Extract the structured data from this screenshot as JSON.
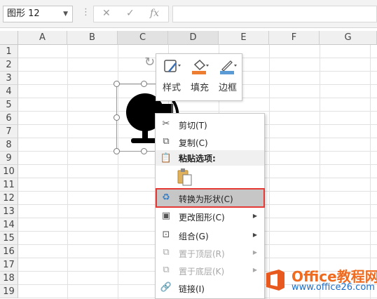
{
  "formula_bar": {
    "name_box": "图形 12",
    "more_icon": "more-vertical-icon",
    "cancel_icon": "close-icon",
    "enter_icon": "check-icon",
    "function_icon": "fx",
    "formula_value": ""
  },
  "columns": [
    "A",
    "B",
    "C",
    "D",
    "E",
    "F",
    "G"
  ],
  "rows": [
    "1",
    "2",
    "3",
    "4",
    "5",
    "6",
    "7",
    "8",
    "9",
    "10",
    "11",
    "12",
    "13",
    "14",
    "15",
    "16",
    "17",
    "18",
    "19"
  ],
  "selected_columns": [
    "C",
    "D"
  ],
  "mini_toolbar": [
    {
      "label": "样式",
      "icon": "style-icon"
    },
    {
      "label": "填充",
      "icon": "fill-bucket-icon"
    },
    {
      "label": "边框",
      "icon": "border-pen-icon"
    }
  ],
  "colors": {
    "fill_accent": "#ed7d31",
    "border_accent": "#5b9bd5",
    "highlight_border": "#e53935"
  },
  "context_menu": {
    "cut": "剪切(T)",
    "copy": "复制(C)",
    "paste_options": "粘贴选项:",
    "convert_to_shape": "转换为形状(C)",
    "change_graphic": "更改图形(C)",
    "group": "组合(G)",
    "bring_to_front": "置于顶层(R)",
    "send_to_back": "置于底层(K)",
    "link": "链接(I)"
  },
  "watermark": {
    "title": "Office教程网",
    "url": "www.office26.com"
  }
}
